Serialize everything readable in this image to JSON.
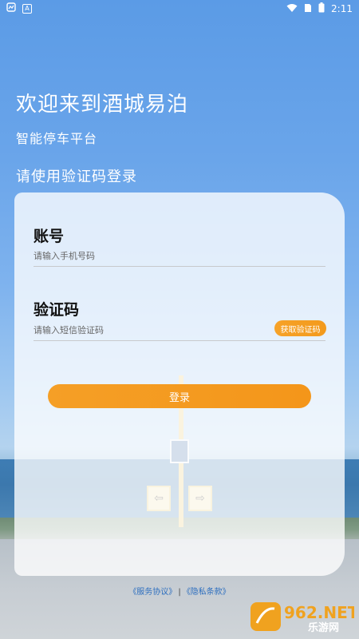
{
  "status_bar": {
    "notif_icon_1": "notification-icon",
    "notif_icon_2_text": "A",
    "time": "2:11"
  },
  "header": {
    "welcome": "欢迎来到酒城易泊",
    "subtitle": "智能停车平台",
    "mode_hint": "请使用验证码登录"
  },
  "form": {
    "account_label": "账号",
    "account_placeholder": "请输入手机号码",
    "code_label": "验证码",
    "code_placeholder": "请输入短信验证码",
    "get_code_label": "获取验证码",
    "login_label": "登录"
  },
  "footer": {
    "service_link": "《服务协议》",
    "separator": "|",
    "privacy_link": "《隐私条款》"
  },
  "watermark": {
    "brand": "962.NET",
    "sub": "乐游网"
  },
  "colors": {
    "accent": "#F59A1F",
    "sky": "#5B9BE6",
    "link": "#2E6FBF"
  }
}
